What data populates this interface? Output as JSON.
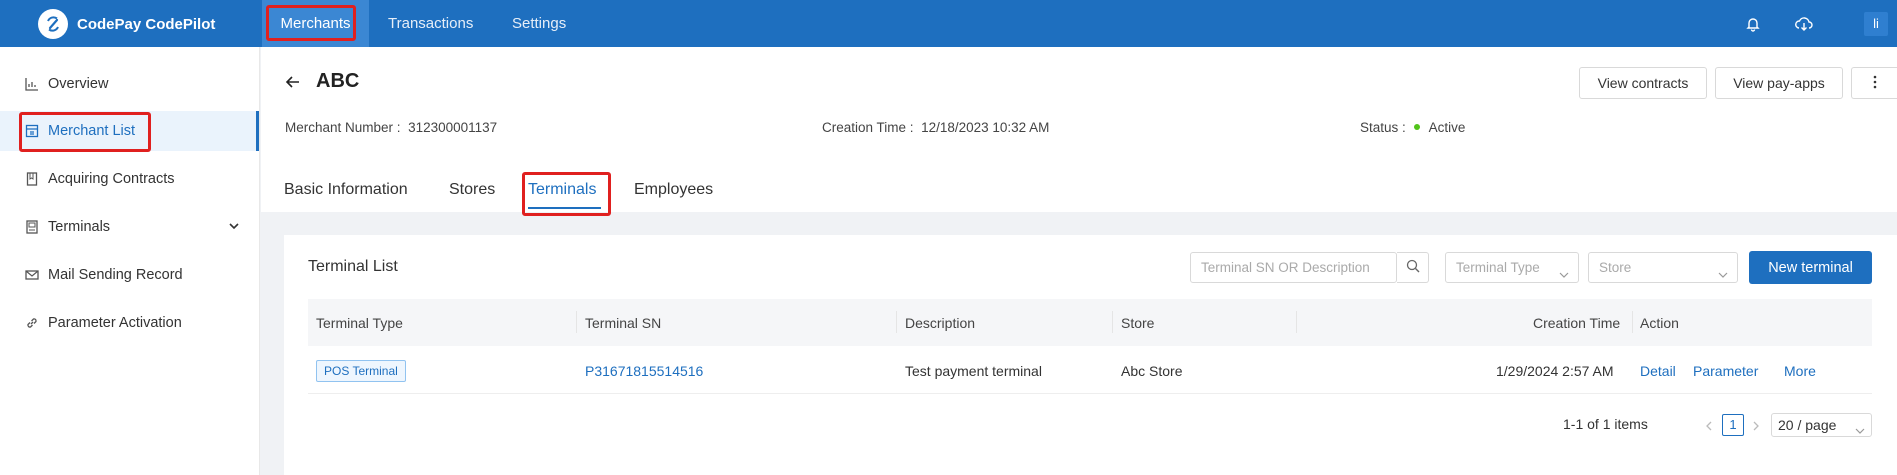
{
  "app": {
    "brand": "CodePay CodePilot"
  },
  "topnav": {
    "merchants": "Merchants",
    "transactions": "Transactions",
    "settings": "Settings",
    "avatar": "li"
  },
  "sidebar": {
    "items": [
      {
        "label": "Overview",
        "icon": "chart-icon"
      },
      {
        "label": "Merchant List",
        "icon": "building-icon"
      },
      {
        "label": "Acquiring Contracts",
        "icon": "book-icon"
      },
      {
        "label": "Terminals",
        "icon": "terminal-icon"
      },
      {
        "label": "Mail Sending Record",
        "icon": "mail-icon"
      },
      {
        "label": "Parameter Activation",
        "icon": "link-icon"
      }
    ]
  },
  "page": {
    "title": "ABC",
    "buttons": {
      "view_contracts": "View contracts",
      "view_payapps": "View pay-apps"
    },
    "meta": {
      "merchant_number_label": "Merchant Number :",
      "merchant_number": "312300001137",
      "creation_time_label": "Creation Time :",
      "creation_time": "12/18/2023 10:32 AM",
      "status_label": "Status :",
      "status": "Active"
    },
    "tabs": [
      "Basic Information",
      "Stores",
      "Terminals",
      "Employees"
    ]
  },
  "terminal_list": {
    "title": "Terminal List",
    "search_placeholder": "Terminal SN OR Description",
    "terminal_type_placeholder": "Terminal Type",
    "store_placeholder": "Store",
    "new_button": "New terminal",
    "columns": [
      "Terminal Type",
      "Terminal SN",
      "Description",
      "Store",
      "Creation Time",
      "Action"
    ],
    "rows": [
      {
        "type": "POS Terminal",
        "sn": "P31671815514516",
        "description": "Test payment terminal",
        "store": "Abc Store",
        "creation_time": "1/29/2024 2:57 AM",
        "actions": [
          "Detail",
          "Parameter",
          "More"
        ]
      }
    ],
    "pagination": {
      "total": "1-1 of 1 items",
      "page": "1",
      "page_size": "20 / page"
    }
  },
  "colors": {
    "primary": "#1e6fbf",
    "highlight": "#e0201f",
    "status_active": "#52c41a"
  }
}
